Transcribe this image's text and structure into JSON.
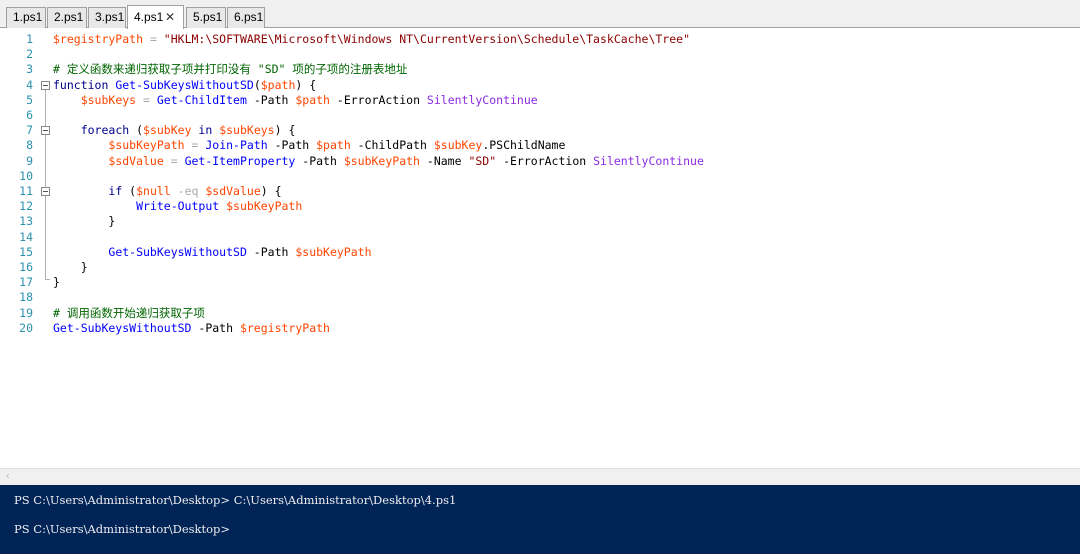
{
  "tabs": [
    {
      "label": "1.ps1",
      "active": false
    },
    {
      "label": "2.ps1",
      "active": false
    },
    {
      "label": "3.ps1",
      "active": false
    },
    {
      "label": "4.ps1",
      "active": true,
      "close_glyph": "✕"
    },
    {
      "label": "5.ps1",
      "active": false
    },
    {
      "label": "6.ps1",
      "active": false
    }
  ],
  "editor": {
    "lines": [
      {
        "n": "1",
        "tokens": [
          [
            "var",
            "$registryPath"
          ],
          [
            "op",
            " = "
          ],
          [
            "str",
            "\"HKLM:\\SOFTWARE\\Microsoft\\Windows NT\\CurrentVersion\\Schedule\\TaskCache\\Tree\""
          ]
        ]
      },
      {
        "n": "2",
        "tokens": []
      },
      {
        "n": "3",
        "tokens": [
          [
            "cmt",
            "# 定义函数来递归获取子项并打印没有 \"SD\" 项的子项的注册表地址"
          ]
        ]
      },
      {
        "n": "4",
        "fold": true,
        "tokens": [
          [
            "kw",
            "function"
          ],
          [
            "pl",
            " "
          ],
          [
            "cmd",
            "Get-SubKeysWithoutSD"
          ],
          [
            "pl",
            "("
          ],
          [
            "var",
            "$path"
          ],
          [
            "pl",
            ") {"
          ]
        ]
      },
      {
        "n": "5",
        "tokens": [
          [
            "pl",
            "    "
          ],
          [
            "var",
            "$subKeys"
          ],
          [
            "op",
            " = "
          ],
          [
            "cmd",
            "Get-ChildItem"
          ],
          [
            "pl",
            " -Path "
          ],
          [
            "var",
            "$path"
          ],
          [
            "pl",
            " -ErrorAction "
          ],
          [
            "arg",
            "SilentlyContinue"
          ]
        ]
      },
      {
        "n": "6",
        "tokens": []
      },
      {
        "n": "7",
        "fold": true,
        "tokens": [
          [
            "pl",
            "    "
          ],
          [
            "kw",
            "foreach"
          ],
          [
            "pl",
            " ("
          ],
          [
            "var",
            "$subKey"
          ],
          [
            "kw",
            " in "
          ],
          [
            "var",
            "$subKeys"
          ],
          [
            "pl",
            ") {"
          ]
        ]
      },
      {
        "n": "8",
        "tokens": [
          [
            "pl",
            "        "
          ],
          [
            "var",
            "$subKeyPath"
          ],
          [
            "op",
            " = "
          ],
          [
            "cmd",
            "Join-Path"
          ],
          [
            "pl",
            " -Path "
          ],
          [
            "var",
            "$path"
          ],
          [
            "pl",
            " -ChildPath "
          ],
          [
            "var",
            "$subKey"
          ],
          [
            "pl",
            "."
          ],
          [
            "mem",
            "PSChildName"
          ]
        ]
      },
      {
        "n": "9",
        "tokens": [
          [
            "pl",
            "        "
          ],
          [
            "var",
            "$sdValue"
          ],
          [
            "op",
            " = "
          ],
          [
            "cmd",
            "Get-ItemProperty"
          ],
          [
            "pl",
            " -Path "
          ],
          [
            "var",
            "$subKeyPath"
          ],
          [
            "pl",
            " -Name "
          ],
          [
            "str",
            "\"SD\""
          ],
          [
            "pl",
            " -ErrorAction "
          ],
          [
            "arg",
            "SilentlyContinue"
          ]
        ]
      },
      {
        "n": "10",
        "tokens": []
      },
      {
        "n": "11",
        "fold": true,
        "tokens": [
          [
            "pl",
            "        "
          ],
          [
            "kw",
            "if"
          ],
          [
            "pl",
            " ("
          ],
          [
            "var",
            "$null"
          ],
          [
            "op",
            " -eq "
          ],
          [
            "var",
            "$sdValue"
          ],
          [
            "pl",
            ") {"
          ]
        ]
      },
      {
        "n": "12",
        "tokens": [
          [
            "pl",
            "            "
          ],
          [
            "cmd",
            "Write-Output"
          ],
          [
            "pl",
            " "
          ],
          [
            "var",
            "$subKeyPath"
          ]
        ]
      },
      {
        "n": "13",
        "tokens": [
          [
            "pl",
            "        }"
          ]
        ]
      },
      {
        "n": "14",
        "tokens": []
      },
      {
        "n": "15",
        "tokens": [
          [
            "pl",
            "        "
          ],
          [
            "cmd",
            "Get-SubKeysWithoutSD"
          ],
          [
            "pl",
            " -Path "
          ],
          [
            "var",
            "$subKeyPath"
          ]
        ]
      },
      {
        "n": "16",
        "tokens": [
          [
            "pl",
            "    }"
          ]
        ]
      },
      {
        "n": "17",
        "tokens": [
          [
            "pl",
            "}"
          ]
        ]
      },
      {
        "n": "18",
        "tokens": []
      },
      {
        "n": "19",
        "tokens": [
          [
            "cmt",
            "# 调用函数开始递归获取子项"
          ]
        ]
      },
      {
        "n": "20",
        "tokens": [
          [
            "cmd",
            "Get-SubKeysWithoutSD"
          ],
          [
            "pl",
            " -Path "
          ],
          [
            "var",
            "$registryPath"
          ]
        ]
      }
    ]
  },
  "console": {
    "lines": [
      "PS C:\\Users\\Administrator\\Desktop> C:\\Users\\Administrator\\Desktop\\4.ps1",
      "PS C:\\Users\\Administrator\\Desktop>"
    ]
  },
  "colors": {
    "variable": "#ff4500",
    "string": "#8b0000",
    "comment": "#006400",
    "command": "#0000ff",
    "keyword": "#00008b",
    "operator": "#a9a9a9",
    "argument": "#8a2be2",
    "line_number": "#2b91af",
    "console_bg": "#012456"
  },
  "icons": {
    "tab_close": "close-icon",
    "fold": "collapse-minus-icon",
    "scroll_left": "chevron-left-icon"
  }
}
